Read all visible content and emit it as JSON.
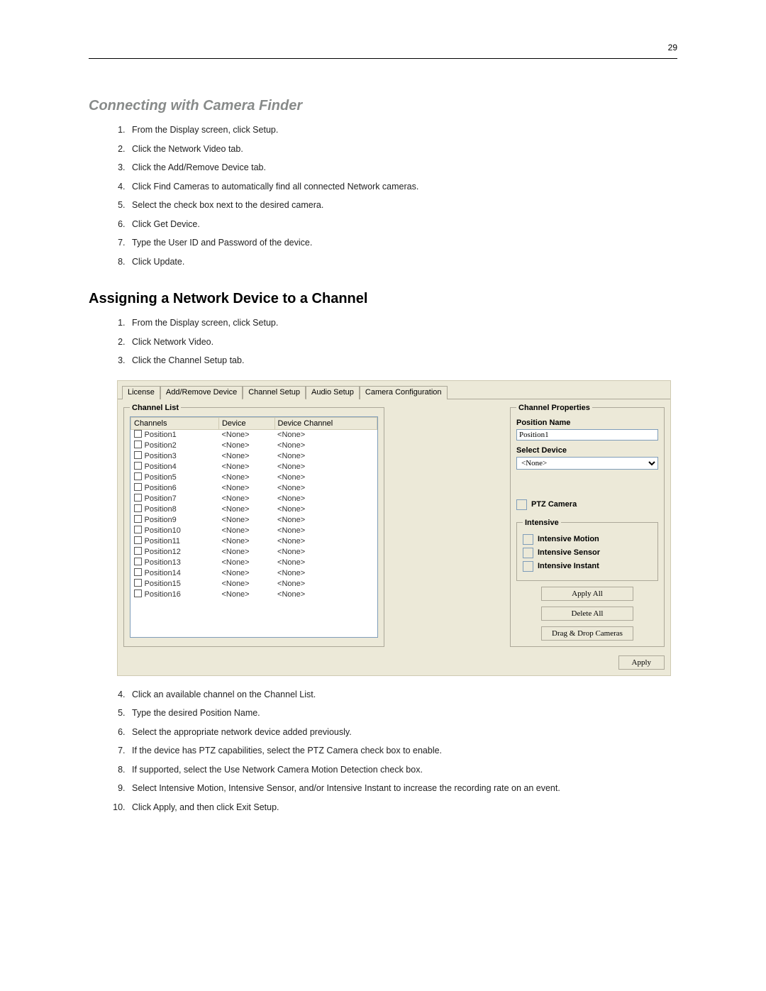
{
  "page_number": "29",
  "headings": {
    "sub1": "Connecting with Camera Finder",
    "main2": "Assigning a Network Device to a Channel"
  },
  "steps_a": [
    "From the Display screen, click Setup.",
    "Click the Network Video tab.",
    "Click the Add/Remove Device tab.",
    "Click Find Cameras to automatically find all connected Network cameras.",
    "Select the check box next to the desired camera.",
    "Click Get Device.",
    "Type the User ID and Password of the device.",
    "Click Update."
  ],
  "steps_b_pre": [
    "From the Display screen, click Setup.",
    "Click Network Video.",
    "Click the Channel Setup tab."
  ],
  "steps_b_post": [
    "Click an available channel on the Channel List.",
    "Type the desired Position Name.",
    "Select the appropriate network device added previously.",
    "If the device has PTZ capabilities, select the PTZ Camera check box to enable.",
    "If supported, select the Use Network Camera Motion Detection check box.",
    "Select Intensive Motion, Intensive Sensor, and/or Intensive Instant to increase the recording rate on an event.",
    "Click Apply, and then click Exit Setup."
  ],
  "ui": {
    "tabs": [
      "License",
      "Add/Remove Device",
      "Channel Setup",
      "Audio Setup",
      "Camera Configuration"
    ],
    "active_tab": "Channel Setup",
    "channel_list": {
      "legend": "Channel List",
      "headers": [
        "Channels",
        "Device",
        "Device Channel"
      ],
      "rows": [
        {
          "c": "Position1",
          "d": "<None>",
          "dc": "<None>"
        },
        {
          "c": "Position2",
          "d": "<None>",
          "dc": "<None>"
        },
        {
          "c": "Position3",
          "d": "<None>",
          "dc": "<None>"
        },
        {
          "c": "Position4",
          "d": "<None>",
          "dc": "<None>"
        },
        {
          "c": "Position5",
          "d": "<None>",
          "dc": "<None>"
        },
        {
          "c": "Position6",
          "d": "<None>",
          "dc": "<None>"
        },
        {
          "c": "Position7",
          "d": "<None>",
          "dc": "<None>"
        },
        {
          "c": "Position8",
          "d": "<None>",
          "dc": "<None>"
        },
        {
          "c": "Position9",
          "d": "<None>",
          "dc": "<None>"
        },
        {
          "c": "Position10",
          "d": "<None>",
          "dc": "<None>"
        },
        {
          "c": "Position11",
          "d": "<None>",
          "dc": "<None>"
        },
        {
          "c": "Position12",
          "d": "<None>",
          "dc": "<None>"
        },
        {
          "c": "Position13",
          "d": "<None>",
          "dc": "<None>"
        },
        {
          "c": "Position14",
          "d": "<None>",
          "dc": "<None>"
        },
        {
          "c": "Position15",
          "d": "<None>",
          "dc": "<None>"
        },
        {
          "c": "Position16",
          "d": "<None>",
          "dc": "<None>"
        }
      ]
    },
    "props": {
      "legend": "Channel Properties",
      "position_label": "Position Name",
      "position_value": "Position1",
      "select_device_label": "Select Device",
      "select_device_value": "<None>",
      "ptz_label": "PTZ Camera",
      "intensive_legend": "Intensive",
      "int_motion": "Intensive Motion",
      "int_sensor": "Intensive Sensor",
      "int_instant": "Intensive Instant",
      "apply_all": "Apply All",
      "delete_all": "Delete All",
      "drag_drop": "Drag & Drop Cameras"
    },
    "apply": "Apply"
  }
}
